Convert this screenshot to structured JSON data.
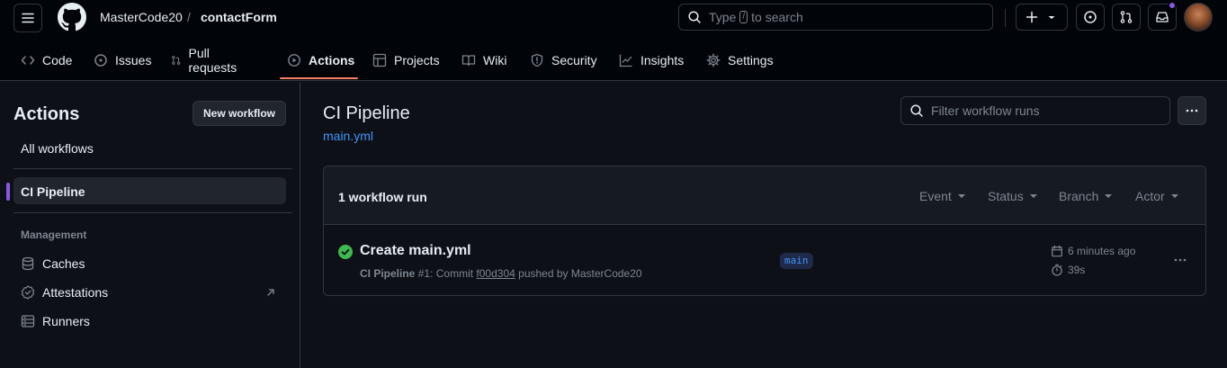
{
  "header": {
    "owner": "MasterCode20",
    "separator": "/",
    "repo": "contactForm",
    "search_prefix": "Type",
    "search_key": "/",
    "search_suffix": "to search"
  },
  "nav": {
    "tabs": [
      {
        "label": "Code",
        "icon": "code-icon"
      },
      {
        "label": "Issues",
        "icon": "issue-icon"
      },
      {
        "label": "Pull requests",
        "icon": "pull-request-icon"
      },
      {
        "label": "Actions",
        "icon": "play-icon",
        "active": true
      },
      {
        "label": "Projects",
        "icon": "table-icon"
      },
      {
        "label": "Wiki",
        "icon": "book-icon"
      },
      {
        "label": "Security",
        "icon": "shield-icon"
      },
      {
        "label": "Insights",
        "icon": "graph-icon"
      },
      {
        "label": "Settings",
        "icon": "gear-icon"
      }
    ]
  },
  "sidebar": {
    "title": "Actions",
    "new_workflow": "New workflow",
    "all_workflows": "All workflows",
    "selected_workflow": "CI Pipeline",
    "management_heading": "Management",
    "items": [
      {
        "label": "Caches",
        "icon": "database-icon"
      },
      {
        "label": "Attestations",
        "icon": "verified-icon",
        "external": true
      },
      {
        "label": "Runners",
        "icon": "server-icon"
      }
    ]
  },
  "main": {
    "title": "CI Pipeline",
    "file": "main.yml",
    "filter_placeholder": "Filter workflow runs",
    "run_count": "1 workflow run",
    "filters": [
      "Event",
      "Status",
      "Branch",
      "Actor"
    ],
    "runs": [
      {
        "title": "Create main.yml",
        "workflow": "CI Pipeline",
        "number": "#1",
        "commit_prefix": "Commit",
        "sha": "f00d304",
        "pushed_by": "pushed by MasterCode20",
        "branch": "main",
        "time": "6 minutes ago",
        "duration": "39s",
        "status": "success"
      }
    ]
  },
  "colors": {
    "background": "#0d1117",
    "header": "#010409",
    "accent": "#8957e5",
    "link": "#4493f8",
    "success": "#3fb950",
    "tab_underline": "#f78166"
  }
}
